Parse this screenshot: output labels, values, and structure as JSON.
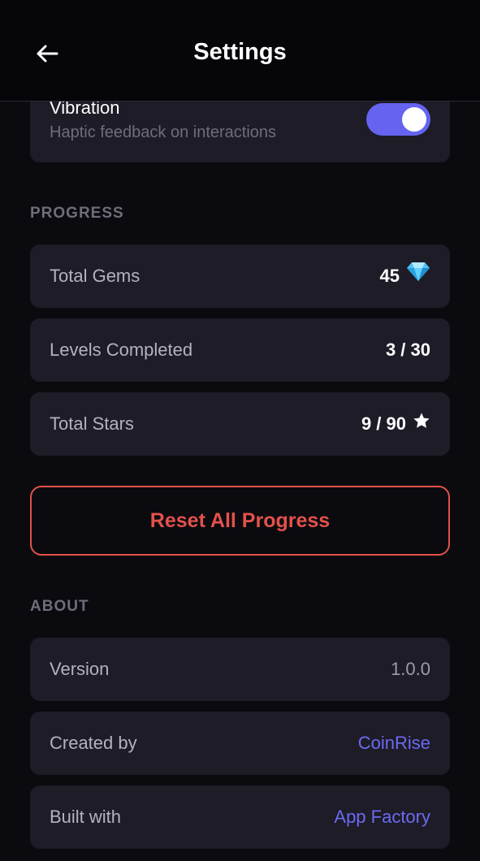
{
  "header": {
    "title": "Settings",
    "back_icon": "arrow-left-icon"
  },
  "vibration": {
    "title": "Vibration",
    "subtitle": "Haptic feedback on interactions",
    "enabled": true,
    "toggle_color": "#6563f0"
  },
  "progress": {
    "section_label": "PROGRESS",
    "total_gems": {
      "label": "Total Gems",
      "value": "45",
      "icon": "gem-icon"
    },
    "levels_completed": {
      "label": "Levels Completed",
      "value": "3 / 30"
    },
    "total_stars": {
      "label": "Total Stars",
      "value": "9 / 90",
      "icon": "star-icon"
    }
  },
  "reset": {
    "label": "Reset All Progress",
    "color": "#e3524a"
  },
  "about": {
    "section_label": "ABOUT",
    "version": {
      "label": "Version",
      "value": "1.0.0"
    },
    "created_by": {
      "label": "Created by",
      "value": "CoinRise"
    },
    "built_with": {
      "label": "Built with",
      "value": "App Factory"
    },
    "link_color": "#6c6af2"
  }
}
